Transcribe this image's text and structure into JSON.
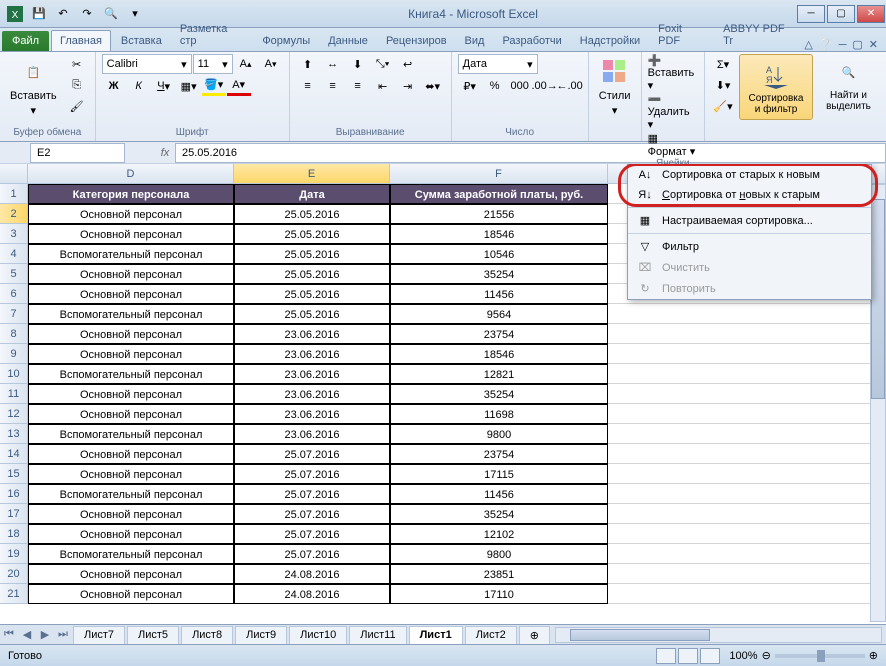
{
  "app": {
    "title": "Книга4  -  Microsoft Excel"
  },
  "tabs": {
    "file": "Файл",
    "home": "Главная",
    "insert": "Вставка",
    "pagelayout": "Разметка стр",
    "formulas": "Формулы",
    "data": "Данные",
    "review": "Рецензиров",
    "view": "Вид",
    "developer": "Разработчи",
    "addins": "Надстройки",
    "foxit": "Foxit PDF",
    "abbyy": "ABBYY PDF Tr"
  },
  "ribbon": {
    "clipboard": {
      "paste": "Вставить",
      "label": "Буфер обмена"
    },
    "font": {
      "name": "Calibri",
      "size": "11",
      "label": "Шрифт"
    },
    "alignment": {
      "label": "Выравнивание"
    },
    "number": {
      "format": "Дата",
      "label": "Число"
    },
    "styles": {
      "btn": "Стили",
      "label": ""
    },
    "cells": {
      "insert": "Вставить",
      "delete": "Удалить",
      "format": "Формат",
      "label": "Ячейки"
    },
    "editing": {
      "sort": "Сортировка и фильтр",
      "find": "Найти и выделить"
    }
  },
  "namebox": "E2",
  "formula": "25.05.2016",
  "columns": [
    "D",
    "E",
    "F"
  ],
  "headers": {
    "cat": "Категория персонала",
    "date": "Дата",
    "sum": "Сумма заработной платы, руб."
  },
  "rows": [
    {
      "n": 2,
      "cat": "Основной персонал",
      "date": "25.05.2016",
      "sum": "21556"
    },
    {
      "n": 3,
      "cat": "Основной персонал",
      "date": "25.05.2016",
      "sum": "18546"
    },
    {
      "n": 4,
      "cat": "Вспомогательный персонал",
      "date": "25.05.2016",
      "sum": "10546"
    },
    {
      "n": 5,
      "cat": "Основной персонал",
      "date": "25.05.2016",
      "sum": "35254"
    },
    {
      "n": 6,
      "cat": "Основной персонал",
      "date": "25.05.2016",
      "sum": "11456"
    },
    {
      "n": 7,
      "cat": "Вспомогательный персонал",
      "date": "25.05.2016",
      "sum": "9564"
    },
    {
      "n": 8,
      "cat": "Основной персонал",
      "date": "23.06.2016",
      "sum": "23754"
    },
    {
      "n": 9,
      "cat": "Основной персонал",
      "date": "23.06.2016",
      "sum": "18546"
    },
    {
      "n": 10,
      "cat": "Вспомогательный персонал",
      "date": "23.06.2016",
      "sum": "12821"
    },
    {
      "n": 11,
      "cat": "Основной персонал",
      "date": "23.06.2016",
      "sum": "35254"
    },
    {
      "n": 12,
      "cat": "Основной персонал",
      "date": "23.06.2016",
      "sum": "11698"
    },
    {
      "n": 13,
      "cat": "Вспомогательный персонал",
      "date": "23.06.2016",
      "sum": "9800"
    },
    {
      "n": 14,
      "cat": "Основной персонал",
      "date": "25.07.2016",
      "sum": "23754"
    },
    {
      "n": 15,
      "cat": "Основной персонал",
      "date": "25.07.2016",
      "sum": "17115"
    },
    {
      "n": 16,
      "cat": "Вспомогательный персонал",
      "date": "25.07.2016",
      "sum": "11456"
    },
    {
      "n": 17,
      "cat": "Основной персонал",
      "date": "25.07.2016",
      "sum": "35254"
    },
    {
      "n": 18,
      "cat": "Основной персонал",
      "date": "25.07.2016",
      "sum": "12102"
    },
    {
      "n": 19,
      "cat": "Вспомогательный персонал",
      "date": "25.07.2016",
      "sum": "9800"
    },
    {
      "n": 20,
      "cat": "Основной персонал",
      "date": "24.08.2016",
      "sum": "23851"
    },
    {
      "n": 21,
      "cat": "Основной персонал",
      "date": "24.08.2016",
      "sum": "17110"
    }
  ],
  "sortmenu": {
    "oldnew": "Сортировка от старых к новым",
    "newold": "Сортировка от новых к старым",
    "custom": "Настраиваемая сортировка...",
    "filter": "Фильтр",
    "clear": "Очистить",
    "reapply": "Повторить"
  },
  "sheets": [
    "Лист7",
    "Лист5",
    "Лист8",
    "Лист9",
    "Лист10",
    "Лист11",
    "Лист1",
    "Лист2"
  ],
  "activesheet": "Лист1",
  "status": {
    "ready": "Готово",
    "zoom": "100%"
  }
}
